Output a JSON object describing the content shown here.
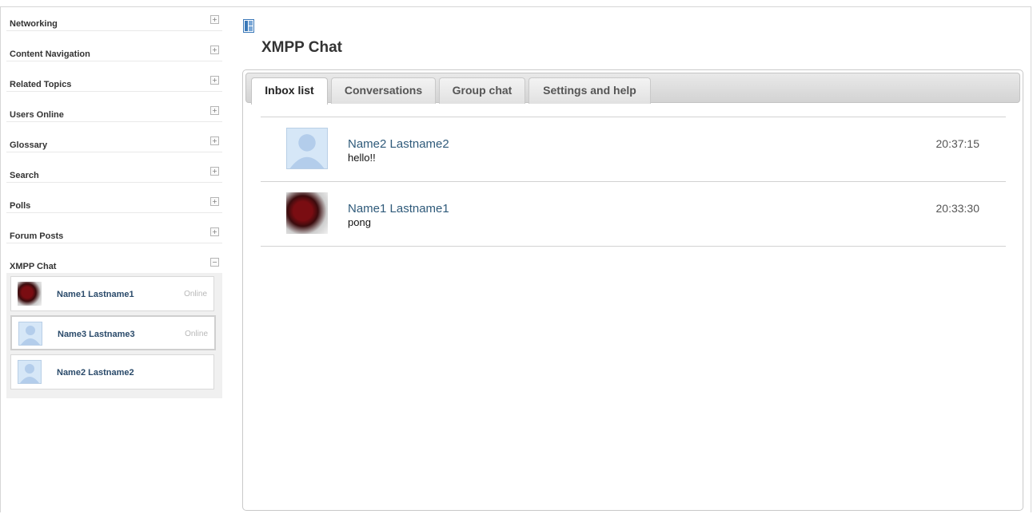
{
  "sidebar": {
    "blocks": [
      {
        "title": "Networking",
        "toggle": "+"
      },
      {
        "title": "Content Navigation",
        "toggle": "+"
      },
      {
        "title": "Related Topics",
        "toggle": "+"
      },
      {
        "title": "Users Online",
        "toggle": "+"
      },
      {
        "title": "Glossary",
        "toggle": "+"
      },
      {
        "title": "Search",
        "toggle": "+"
      },
      {
        "title": "Polls",
        "toggle": "+"
      },
      {
        "title": "Forum Posts",
        "toggle": "+"
      }
    ],
    "chat": {
      "title": "XMPP Chat",
      "toggle": "−",
      "contacts": [
        {
          "name": "Name1 Lastname1",
          "status": "Online",
          "avatar": "photo"
        },
        {
          "name": "Name3 Lastname3",
          "status": "Online",
          "avatar": "default-user"
        },
        {
          "name": "Name2 Lastname2",
          "status": "",
          "avatar": "default-user"
        }
      ]
    }
  },
  "main": {
    "title": "XMPP Chat",
    "tabs": [
      {
        "label": "Inbox list",
        "active": true
      },
      {
        "label": "Conversations",
        "active": false
      },
      {
        "label": "Group chat",
        "active": false
      },
      {
        "label": "Settings and help",
        "active": false
      }
    ],
    "inbox": [
      {
        "sender": "Name2 Lastname2",
        "text": "hello!!",
        "time": "20:37:15",
        "avatar": "default-user"
      },
      {
        "sender": "Name1 Lastname1",
        "text": "pong",
        "time": "20:33:30",
        "avatar": "photo"
      }
    ]
  },
  "colors": {
    "link": "#2f5a7a",
    "accent_icon": "#3a78b8"
  }
}
